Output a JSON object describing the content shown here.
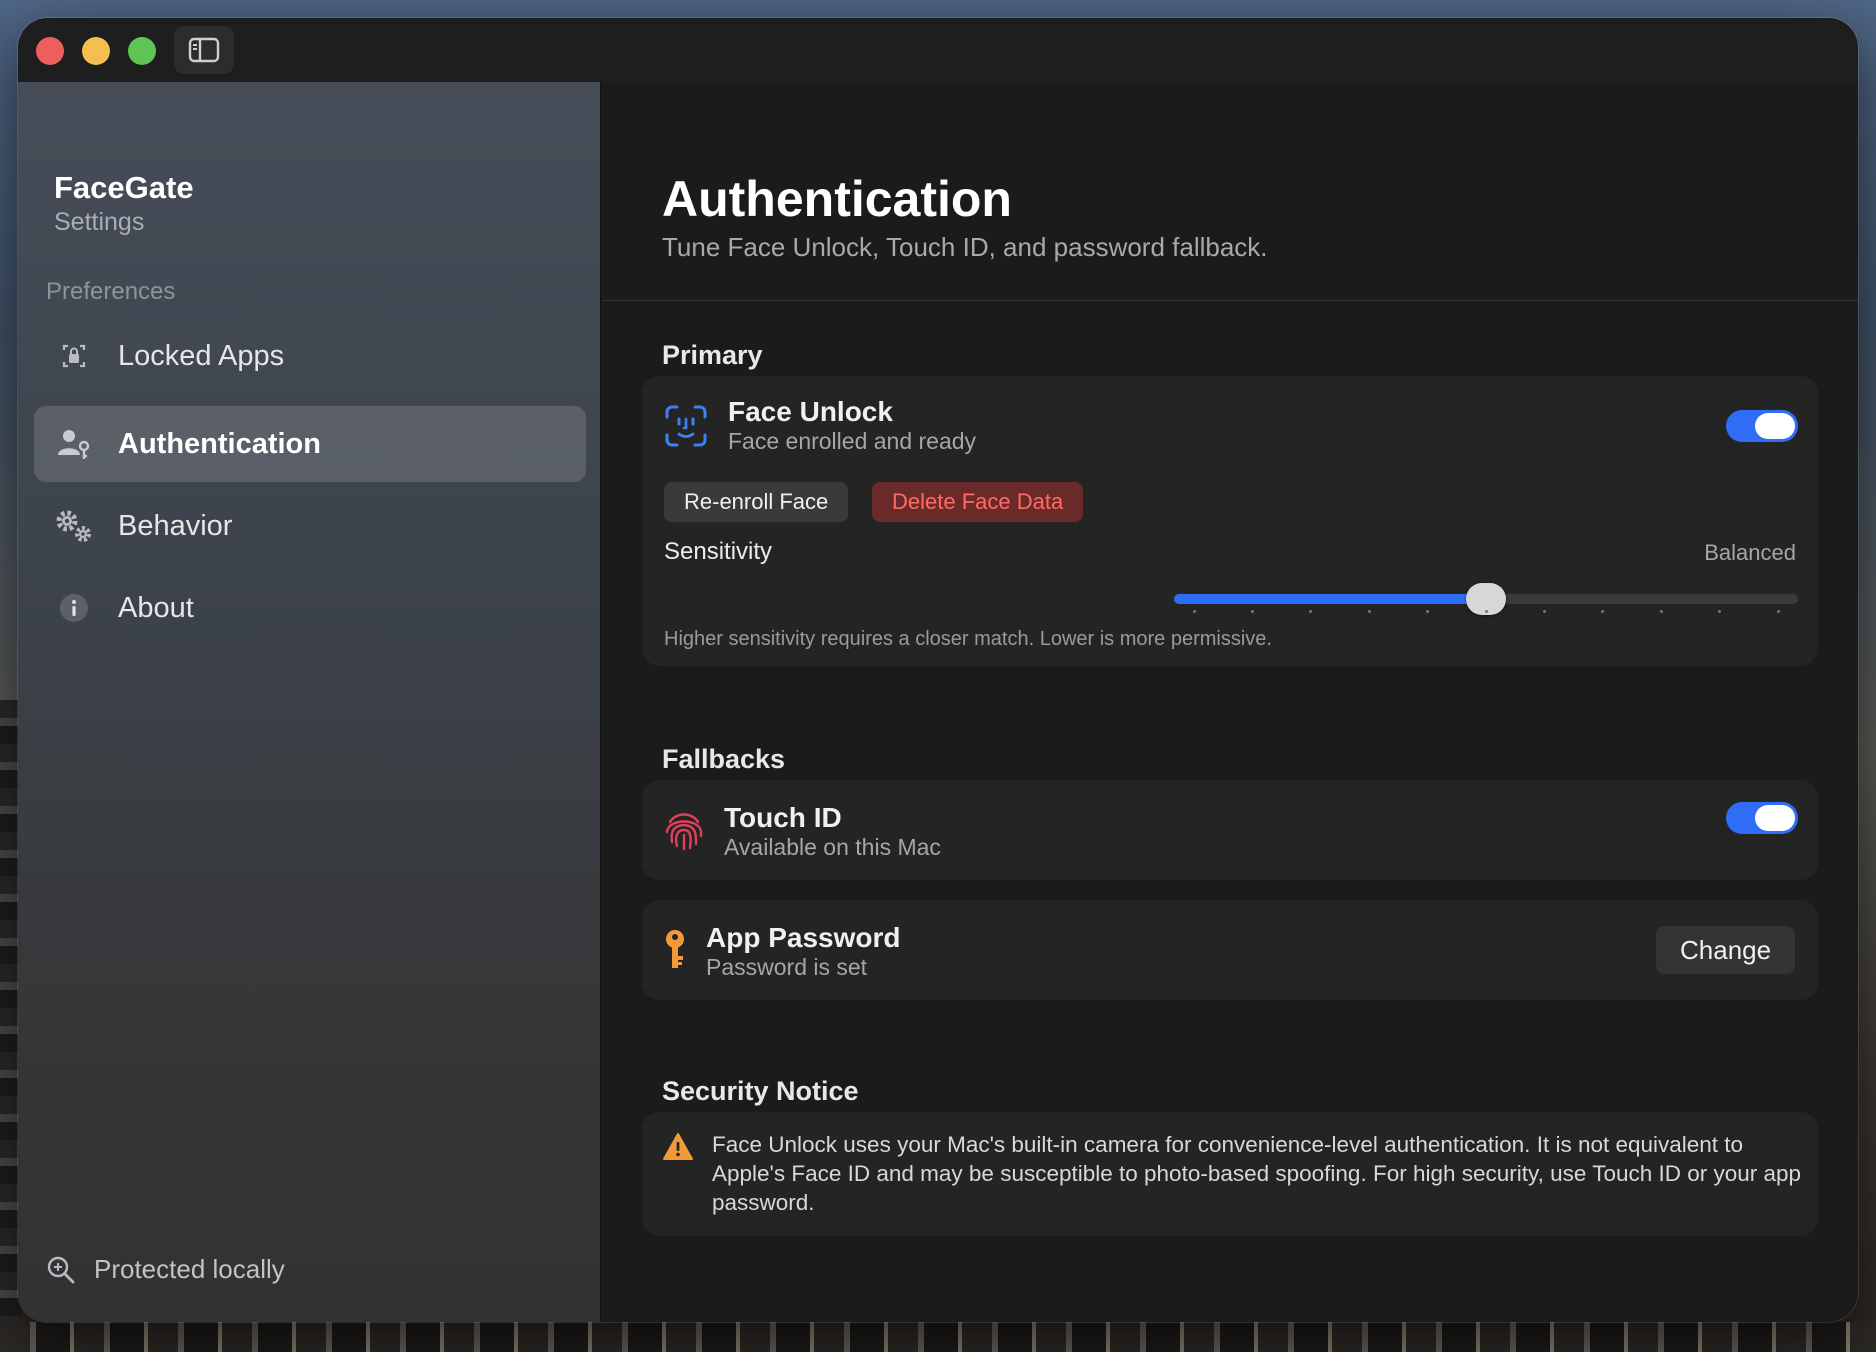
{
  "sidebar": {
    "app_name": "FaceGate",
    "app_subtitle": "Settings",
    "section_label": "Preferences",
    "items": [
      {
        "label": "Locked Apps",
        "icon": "lock-app-icon"
      },
      {
        "label": "Authentication",
        "icon": "person-key-icon",
        "active": true
      },
      {
        "label": "Behavior",
        "icon": "gears-icon"
      },
      {
        "label": "About",
        "icon": "info-icon"
      }
    ],
    "footer_label": "Protected locally"
  },
  "header": {
    "title": "Authentication",
    "subtitle": "Tune Face Unlock, Touch ID, and password fallback."
  },
  "primary": {
    "section_title": "Primary",
    "face_unlock": {
      "title": "Face Unlock",
      "subtitle": "Face enrolled and ready",
      "enabled": true,
      "reenroll_label": "Re-enroll Face",
      "delete_label": "Delete Face Data"
    },
    "sensitivity": {
      "label": "Sensitivity",
      "value_label": "Balanced",
      "level": 0.5,
      "hint": "Higher sensitivity requires a closer match. Lower is more permissive."
    }
  },
  "fallbacks": {
    "section_title": "Fallbacks",
    "touch_id": {
      "title": "Touch ID",
      "subtitle": "Available on this Mac",
      "enabled": true
    },
    "app_password": {
      "title": "App Password",
      "subtitle": "Password is set",
      "change_label": "Change"
    }
  },
  "security_notice": {
    "section_title": "Security Notice",
    "text": "Face Unlock uses your Mac's built-in camera for convenience-level authentication. It is not equivalent to Apple's Face ID and may be susceptible to photo-based spoofing. For high security, use Touch ID or your app password."
  },
  "colors": {
    "accent": "#2f6df6",
    "danger": "#ff6b63",
    "touch_id": "#e0405a",
    "key": "#f29a38",
    "warning": "#f29a38"
  }
}
